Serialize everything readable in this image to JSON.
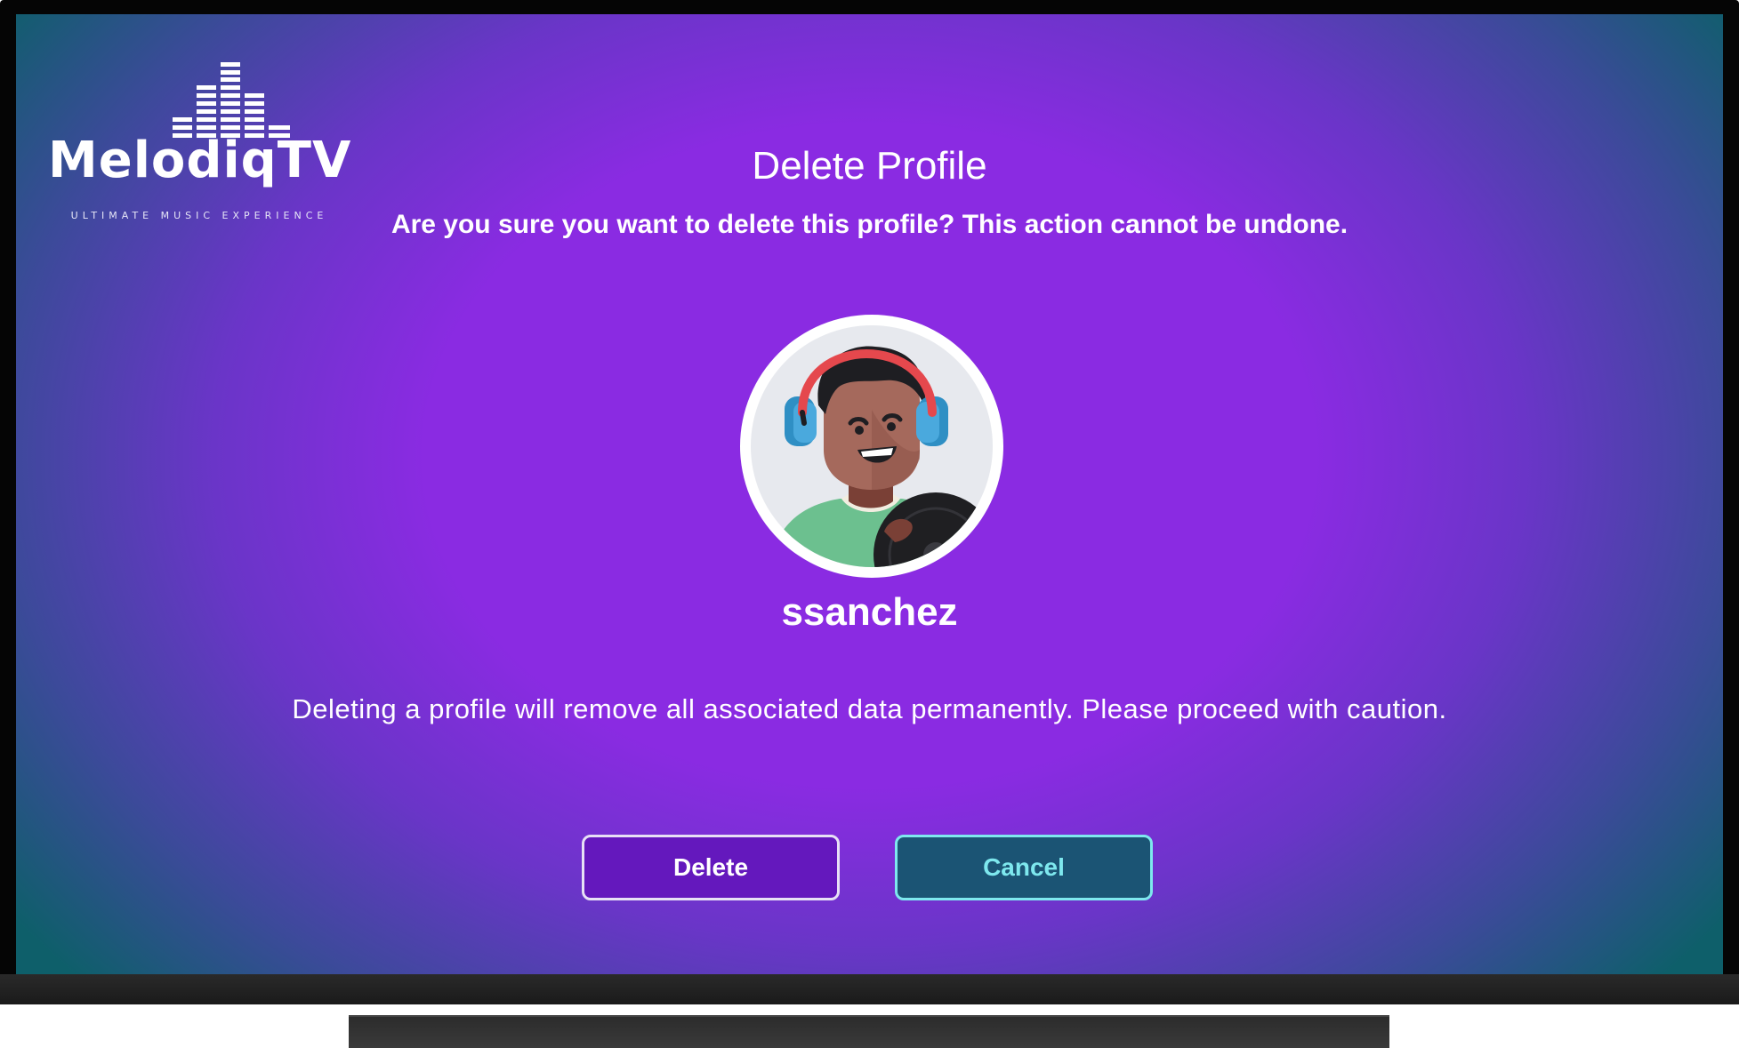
{
  "logo": {
    "name": "MelodiqTV",
    "tagline": "ULTIMATE MUSIC EXPERIENCE"
  },
  "dialog": {
    "title": "Delete Profile",
    "subtitle": "Are you sure you want to delete this profile? This action cannot be undone.",
    "username": "ssanchez",
    "warning": "Deleting a profile will remove all associated data permanently. Please proceed with caution."
  },
  "actions": {
    "delete_label": "Delete",
    "cancel_label": "Cancel"
  },
  "colors": {
    "background_center": "#8a2be2",
    "background_edge": "#0e5f6a",
    "delete_button": "#6418bd",
    "cancel_button": "#1b5474",
    "cancel_accent": "#7ee8ee"
  }
}
